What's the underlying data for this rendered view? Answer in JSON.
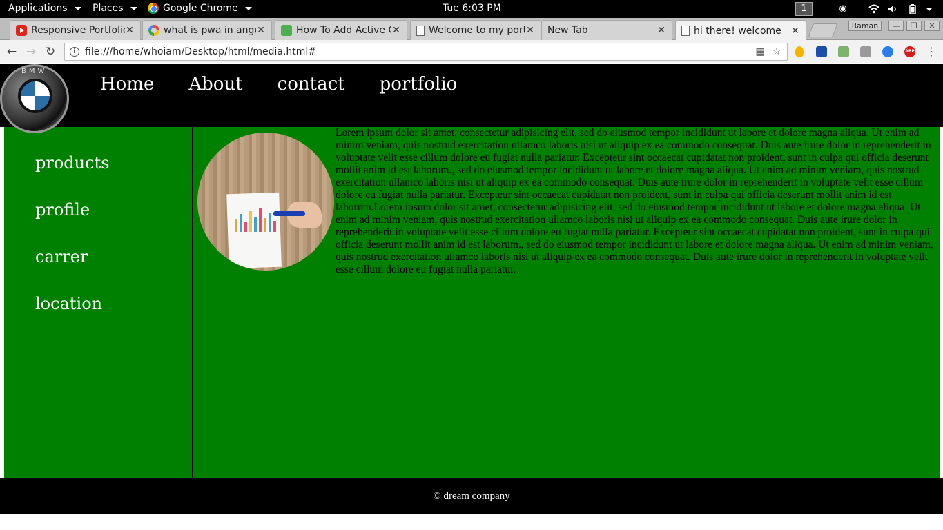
{
  "os_topbar": {
    "applications_label": "Applications",
    "places_label": "Places",
    "active_app_label": "Google Chrome",
    "clock": "Tue  6:03 PM",
    "workspace_number": "1"
  },
  "browser": {
    "tabs": [
      {
        "title": "Responsive Portfolio",
        "favicon": "youtube-icon"
      },
      {
        "title": "what is pwa in angul",
        "favicon": "google-icon"
      },
      {
        "title": "How To Add Active C",
        "favicon": "w3schools-icon"
      },
      {
        "title": "Welcome to my port",
        "favicon": "document-icon"
      },
      {
        "title": "New Tab",
        "favicon": "none"
      },
      {
        "title": "hi there! welcome",
        "favicon": "document-icon"
      }
    ],
    "active_tab_index": 5,
    "profile_name": "Raman",
    "address_url": "file:///home/whoiam/Desktop/html/media.html#",
    "extension_badge": "ABP"
  },
  "site": {
    "nav": [
      "Home",
      "About",
      "contact",
      "portfolio"
    ],
    "sidebar_links": [
      "products",
      "profile",
      "carrer",
      "location"
    ],
    "body_text": "Lorem ipsum dolor sit amet, consectetur adipisicing elit, sed do eiusmod tempor incididunt ut labore et dolore magna aliqua. Ut enim ad minim veniam, quis nostrud exercitation ullamco laboris nisi ut aliquip ex ea commodo consequat. Duis aute irure dolor in reprehenderit in voluptate velit esse cillum dolore eu fugiat nulla pariatur. Excepteur sint occaecat cupidatat non proident, sunt in culpa qui officia deserunt mollit anim id est laborum., sed do eiusmod tempor incididunt ut labore et dolore magna aliqua. Ut enim ad minim veniam, quis nostrud exercitation ullamco laboris nisi ut aliquip ex ea commodo consequat. Duis aute irure dolor in reprehenderit in voluptate velit esse cillum dolore eu fugiat nulla pariatur. Excepteur sint occaecat cupidatat non proident, sunt in culpa qui officia deserunt mollit anim id est laborum.Lorem ipsum dolor sit amet, consectetur adipisicing elit, sed do eiusmod tempor incididunt ut labore et dolore magna aliqua. Ut enim ad minim veniam, quis nostrud exercitation ullamco laboris nisi ut aliquip ex ea commodo consequat. Duis aute irure dolor in reprehenderit in voluptate velit esse cillum dolore eu fugiat nulla pariatur. Excepteur sint occaecat cupidatat non proident, sunt in culpa qui officia deserunt mollit anim id est laborum., sed do eiusmod tempor incididunt ut labore et dolore magna aliqua. Ut enim ad minim veniam, quis nostrud exercitation ullamco laboris nisi ut aliquip ex ea commodo consequat. Duis aute irure dolor in reprehenderit in voluptate velit esse cillum dolore eu fugiat nulla pariatur.",
    "footer_text": "© dream company",
    "colors": {
      "header_bg": "#000000",
      "main_bg": "#008000",
      "link_color": "#ffffff"
    }
  }
}
